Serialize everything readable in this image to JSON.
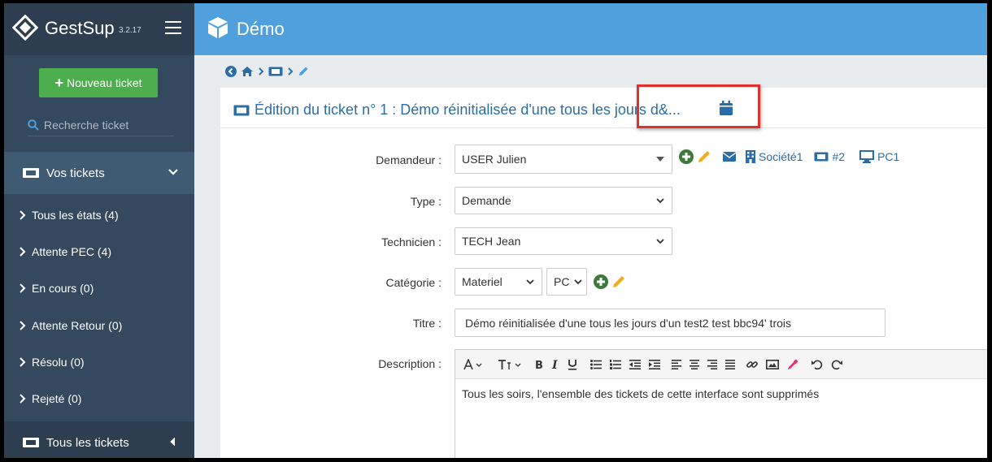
{
  "sidebar": {
    "brand": "GestSup",
    "version": "3.2.17",
    "new_ticket": "Nouveau ticket",
    "search_placeholder": "Recherche ticket",
    "my_tickets": "Vos tickets",
    "items": [
      {
        "label": "Tous les états (4)"
      },
      {
        "label": "Attente PEC (4)"
      },
      {
        "label": "En cours (0)"
      },
      {
        "label": "Attente Retour (0)"
      },
      {
        "label": "Résolu (0)"
      },
      {
        "label": "Rejeté (0)"
      }
    ],
    "all_tickets": "Tous les tickets"
  },
  "header": {
    "title": "Démo"
  },
  "ticket": {
    "title": "Édition du ticket n° 1 : Démo réinitialisée d'une tous les jours d&...",
    "requester_label": "Demandeur :",
    "requester_value": "USER Julien",
    "company": "Société1",
    "ticket_ref": "#2",
    "asset": "PC1",
    "type_label": "Type :",
    "type_value": "Demande",
    "tech_label": "Technicien :",
    "tech_value": "TECH Jean",
    "category_label": "Catégorie :",
    "category_value": "Materiel",
    "subcategory_value": "PC",
    "titre_label": "Titre :",
    "titre_value": "Démo réinitialisée d'une tous les jours d'un test2 test bbc94' trois",
    "description_label": "Description :",
    "description_value": "Tous les soirs, l'ensemble des tickets de cette interface sont supprimés"
  },
  "colors": {
    "accent": "#4fa0dc",
    "sidebar": "#34495e",
    "success": "#4cae4c",
    "highlight": "#e0322c"
  }
}
